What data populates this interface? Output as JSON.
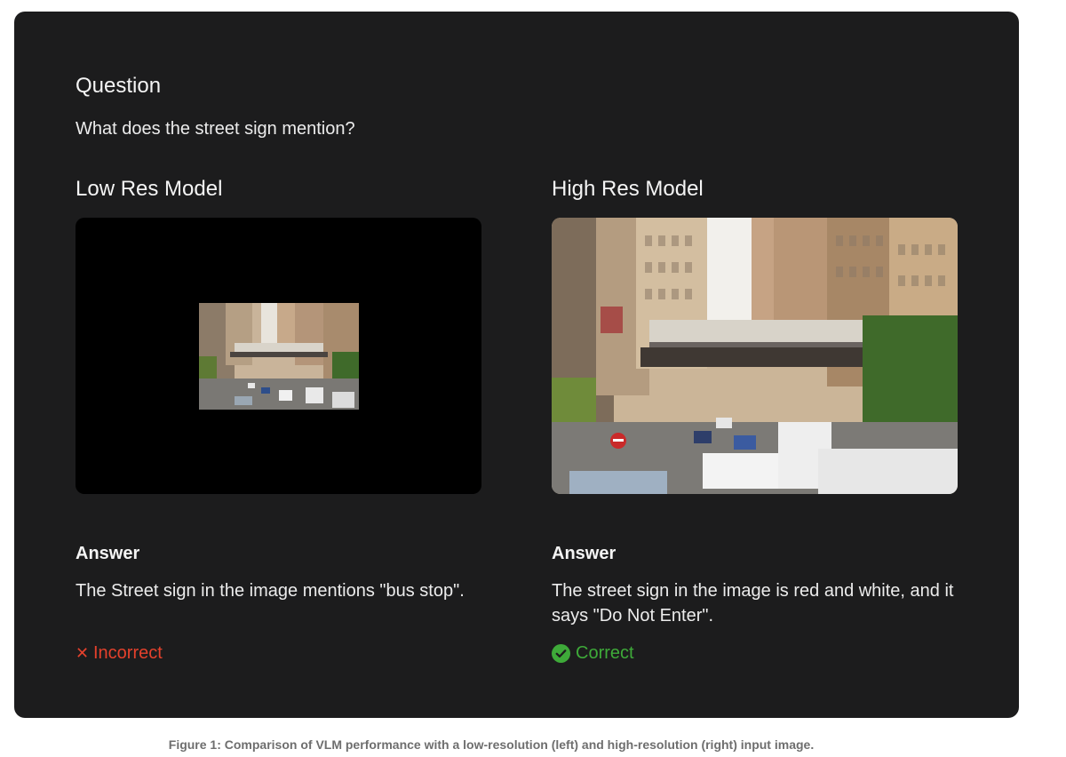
{
  "question": {
    "heading": "Question",
    "text": "What does the street sign mention?"
  },
  "left": {
    "title": "Low Res Model",
    "image_alt": "Low-resolution street scene",
    "answer_label": "Answer",
    "answer_text": "The Street sign in the image mentions \"bus stop\".",
    "verdict": "Incorrect",
    "verdict_icon": "x-icon",
    "verdict_color": "#e5412c"
  },
  "right": {
    "title": "High Res Model",
    "image_alt": "High-resolution street scene",
    "answer_label": "Answer",
    "answer_text": "The street sign in the image is red and white, and it says \"Do Not Enter\".",
    "verdict": "Correct",
    "verdict_icon": "check-circle-icon",
    "verdict_color": "#3eaa39"
  },
  "caption": "Figure 1: Comparison of VLM performance with a low-resolution (left) and high-resolution (right) input image."
}
